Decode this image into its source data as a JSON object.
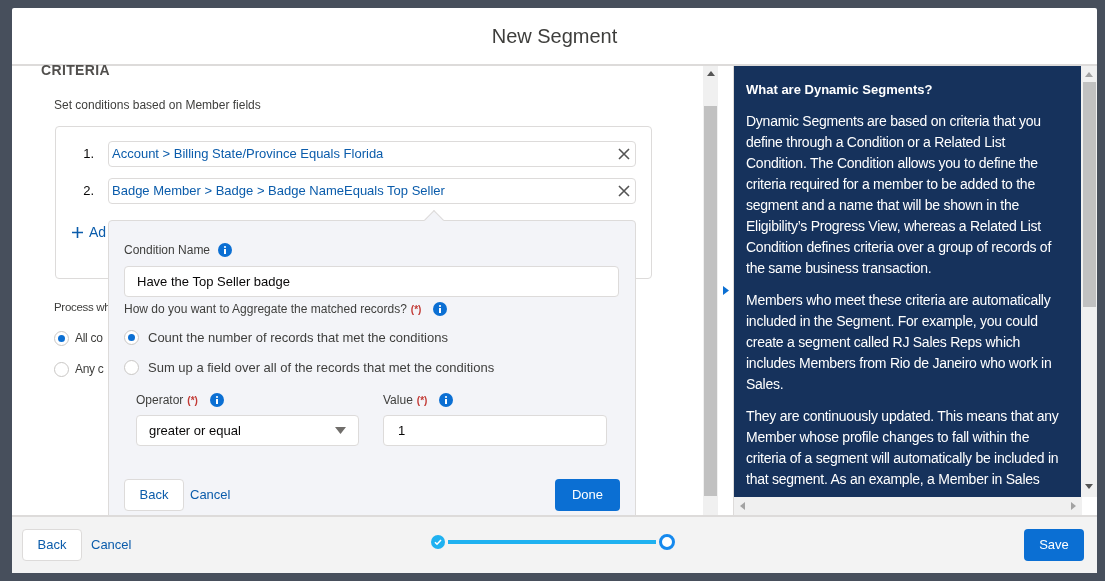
{
  "modal": {
    "title": "New Segment"
  },
  "criteria": {
    "heading": "CRITERIA",
    "description": "Set conditions based on Member fields",
    "conditions": [
      {
        "number": "1.",
        "text": "Account > Billing State/Province Equals Florida"
      },
      {
        "number": "2.",
        "text": "Badge Member > Badge > Badge NameEquals Top Seller"
      }
    ],
    "add_link": "Ad",
    "process_label": "Process wh",
    "process_options": [
      {
        "label": "All co",
        "selected": true
      },
      {
        "label": "Any c",
        "selected": false
      }
    ]
  },
  "popover": {
    "condition_name_label": "Condition Name",
    "condition_name_value": "Have the Top Seller badge",
    "aggregate_question": "How do you want to Aggregate the matched records?",
    "required_mark": "(*)",
    "aggregate_options": [
      {
        "label": "Count the number of records that met the conditions",
        "selected": true
      },
      {
        "label": "Sum up a field over all of the records that met the conditions",
        "selected": false
      }
    ],
    "operator_label": "Operator",
    "operator_required": "(*)",
    "operator_value": "greater or equal",
    "value_label": "Value",
    "value_required": "(*)",
    "value": "1",
    "back": "Back",
    "cancel": "Cancel",
    "done": "Done"
  },
  "help": {
    "title": "What are Dynamic Segments?",
    "paragraphs": [
      "Dynamic Segments are based on criteria that you define through a Condition or a Related List Condition. The Condition allows you to define the criteria required for a member to be added to the segment and a name that will be shown in the Eligibility’s Progress View, whereas a Related List Condition defines criteria over a group of records of the same business transaction.",
      "Members who meet these criteria are automatically included in the Segment. For example, you could create a segment called RJ Sales Reps which includes Members from Rio de Janeiro who work in Sales.",
      "They are continuously updated. This means that any Member whose profile changes to fall within the criteria of a segment will automatically be included in that segment. As an example, a Member in Sales"
    ]
  },
  "footer": {
    "back": "Back",
    "cancel": "Cancel",
    "save": "Save",
    "steps": [
      {
        "completed": true
      },
      {
        "completed": false
      }
    ]
  }
}
